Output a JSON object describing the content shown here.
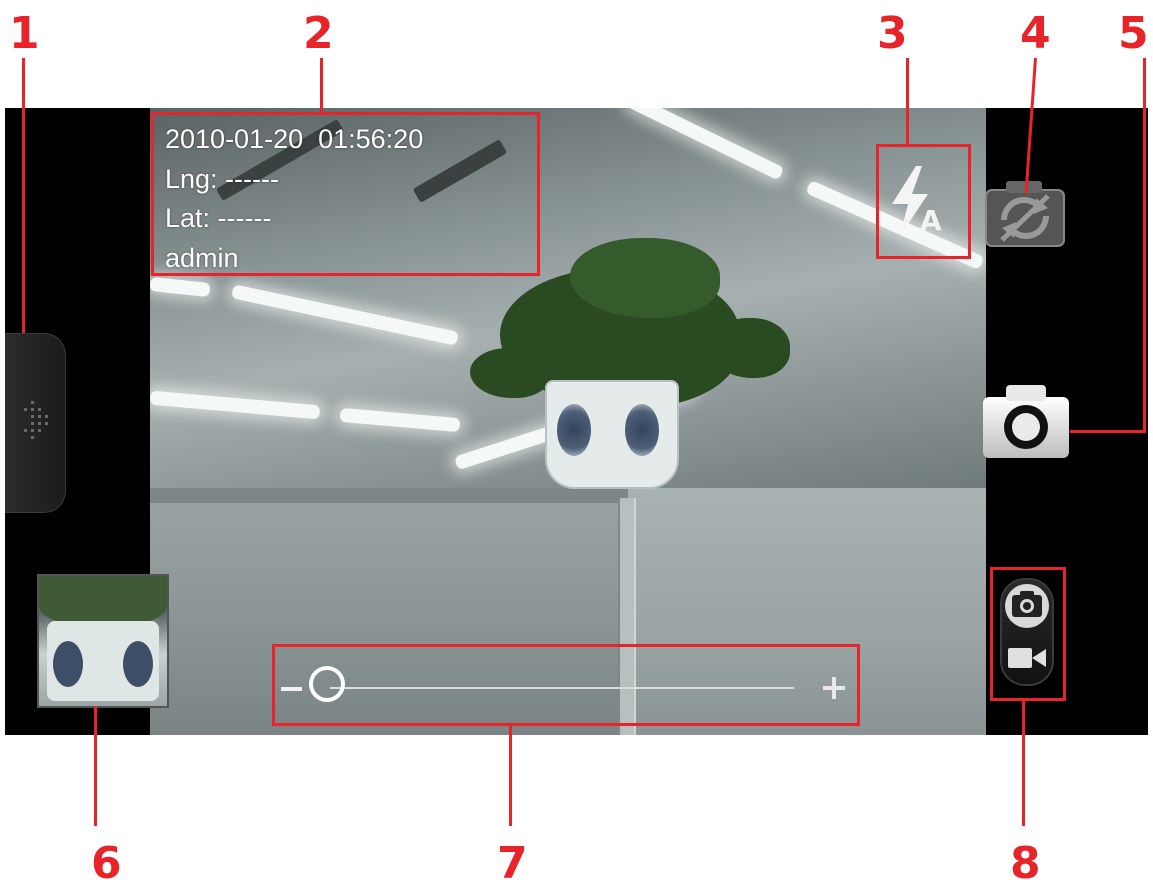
{
  "callouts": [
    "1",
    "2",
    "3",
    "4",
    "5",
    "6",
    "7",
    "8"
  ],
  "overlay": {
    "datetime": "2010-01-20  01:56:20",
    "lng": "Lng: ------",
    "lat": "Lat: ------",
    "user": "admin"
  },
  "icons": {
    "drawer": "drawer-handle-icon",
    "flash": "flash-auto-icon",
    "switch": "switch-camera-icon",
    "shutter": "shutter-icon",
    "mode_photo": "camera-mode-icon",
    "mode_video": "video-mode-icon"
  },
  "zoom": {
    "level": 0.06,
    "minus": "−",
    "plus": "+"
  },
  "colors": {
    "annotation": "#e8242b"
  }
}
